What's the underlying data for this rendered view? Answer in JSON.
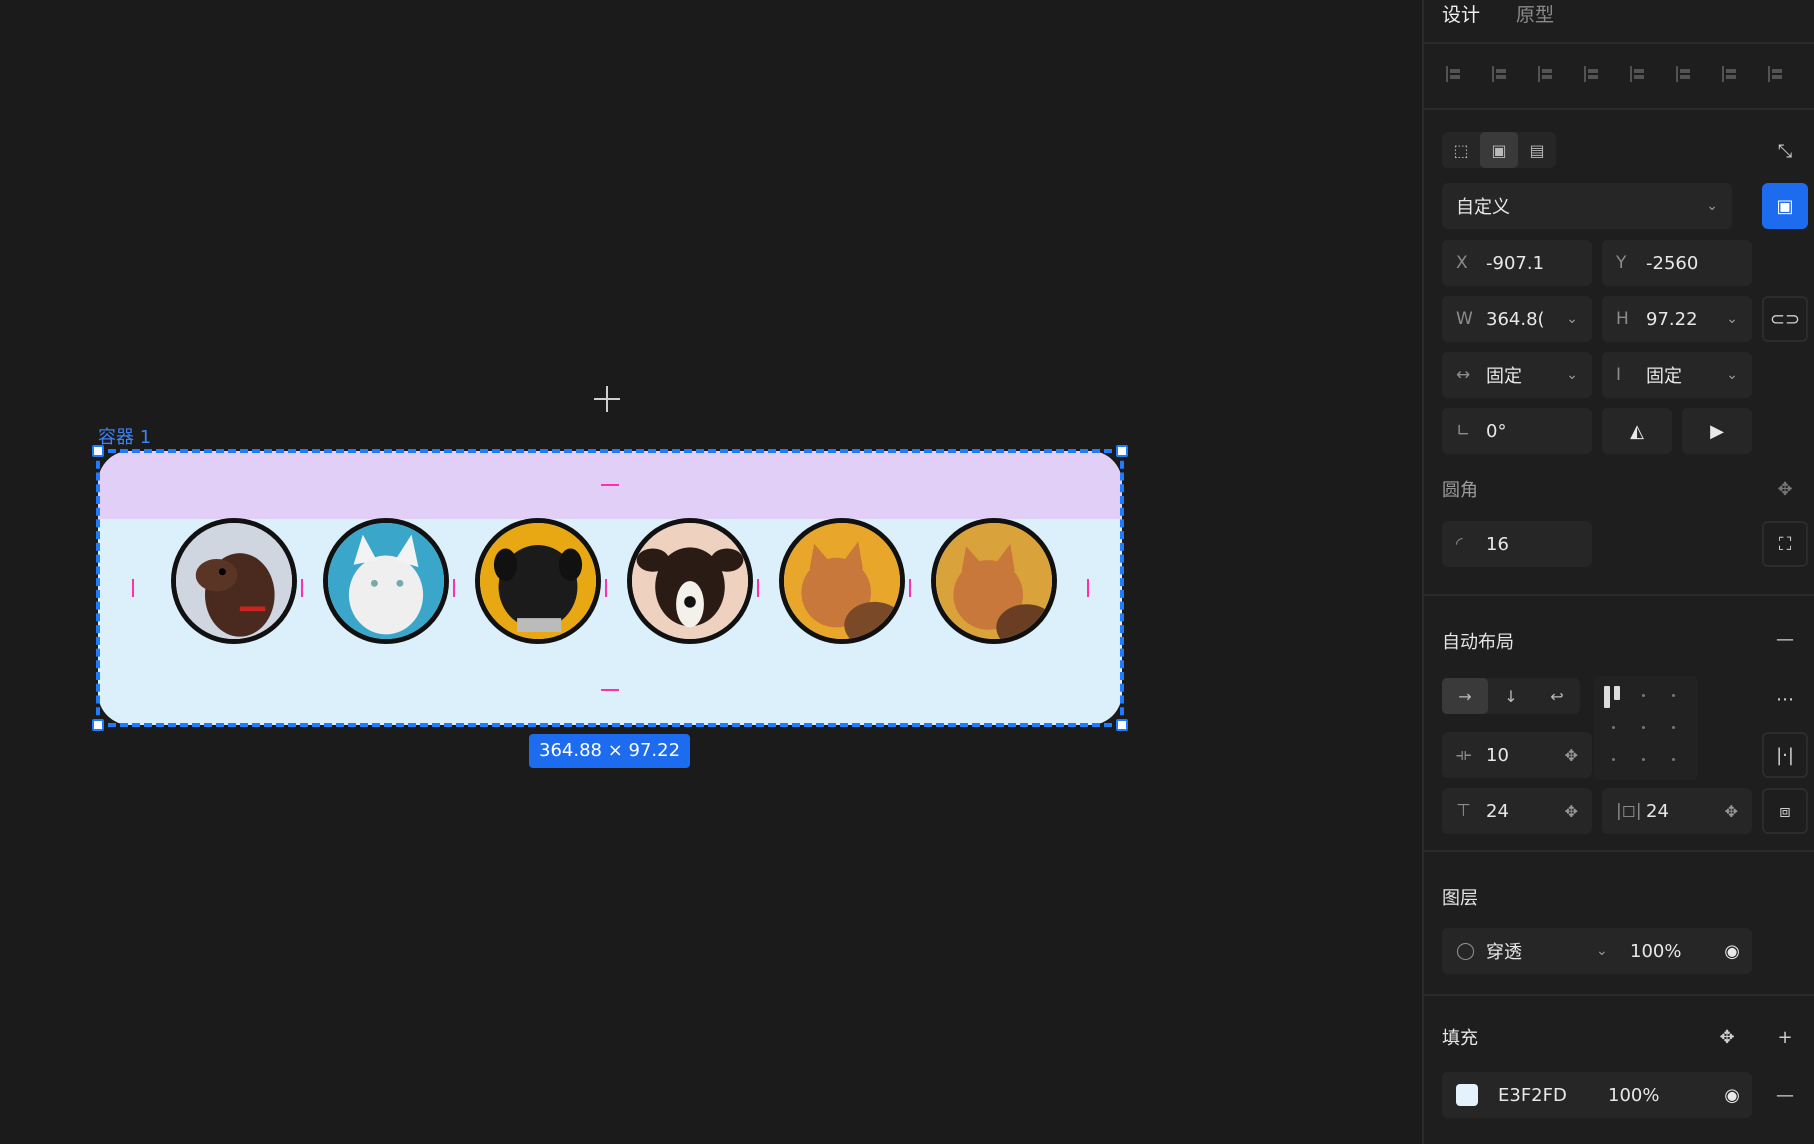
{
  "canvas": {
    "frame_label": "容器 1",
    "size_badge": "364.88 × 97.22",
    "frame_fill": "#E3F2FD",
    "padding_color": "#e2cff8",
    "selection_color": "#1f7bff",
    "avatars": [
      "dog-brown-icon",
      "cat-white-icon",
      "pug-black-icon",
      "dog-tricolor-icon",
      "cat-orange-icon",
      "cat-orange-icon"
    ]
  },
  "panel": {
    "tabs": [
      "设计",
      "原型"
    ],
    "frame_preset": "自定义",
    "x": {
      "label": "X",
      "value": "-907.1"
    },
    "y": {
      "label": "Y",
      "value": "-2560"
    },
    "w": {
      "label": "W",
      "value": "364.8("
    },
    "h": {
      "label": "H",
      "value": "97.22"
    },
    "w_mode": "固定",
    "h_mode": "固定",
    "rotation": "0°",
    "corner_title": "圆角",
    "corner_value": "16",
    "auto_layout_title": "自动布局",
    "gap": "10",
    "pad_v": "24",
    "pad_h": "24",
    "layer_title": "图层",
    "blend": "穿透",
    "opacity": "100%",
    "fill_title": "填充",
    "fill_hex": "E3F2FD",
    "fill_opacity": "100%"
  }
}
